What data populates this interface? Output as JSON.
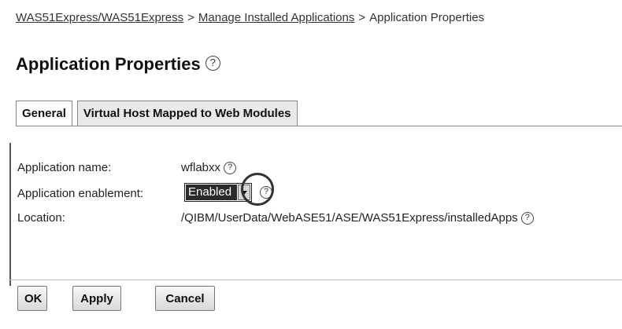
{
  "breadcrumb": {
    "items": [
      {
        "label": "WAS51Express/WAS51Express",
        "link": true
      },
      {
        "label": "Manage Installed Applications",
        "link": true
      },
      {
        "label": "Application Properties",
        "link": false
      }
    ],
    "separator": ">"
  },
  "header": {
    "title": "Application Properties",
    "help_glyph": "?"
  },
  "tabs": [
    {
      "label": "General",
      "active": true
    },
    {
      "label": "Virtual Host Mapped to Web Modules",
      "active": false
    }
  ],
  "form": {
    "app_name": {
      "label": "Application name:",
      "value": "wflabxx"
    },
    "enablement": {
      "label": "Application enablement:",
      "selected": "Enabled"
    },
    "location": {
      "label": "Location:",
      "value": "/QIBM/UserData/WebASE51/ASE/WAS51Express/installedApps"
    }
  },
  "buttons": {
    "ok": "OK",
    "apply": "Apply",
    "cancel": "Cancel"
  },
  "icons": {
    "help": "help-circle-icon",
    "dropdown": "chevron-down-icon"
  },
  "colors": {
    "selected_bg": "#2b2b2b",
    "inactive_tab_bg": "#e9e9e9"
  }
}
